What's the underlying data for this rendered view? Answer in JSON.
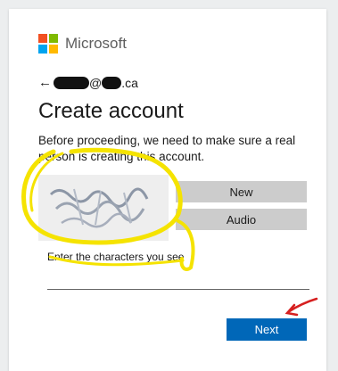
{
  "brand": {
    "name": "Microsoft",
    "colors": [
      "#f25022",
      "#7fba00",
      "#00a4ef",
      "#ffb900"
    ]
  },
  "identity": {
    "back_icon": "back-arrow-icon",
    "email_visible": "@",
    "email_suffix": ".ca"
  },
  "title": "Create account",
  "description": "Before proceeding, we need to make sure a real person is creating this account.",
  "captcha": {
    "new_label": "New",
    "audio_label": "Audio"
  },
  "input": {
    "label": "Enter the characters you see",
    "value": ""
  },
  "actions": {
    "next_label": "Next"
  },
  "colors": {
    "accent": "#0067b8",
    "highlight": "#f5e300",
    "annotation_arrow": "#d62020"
  }
}
